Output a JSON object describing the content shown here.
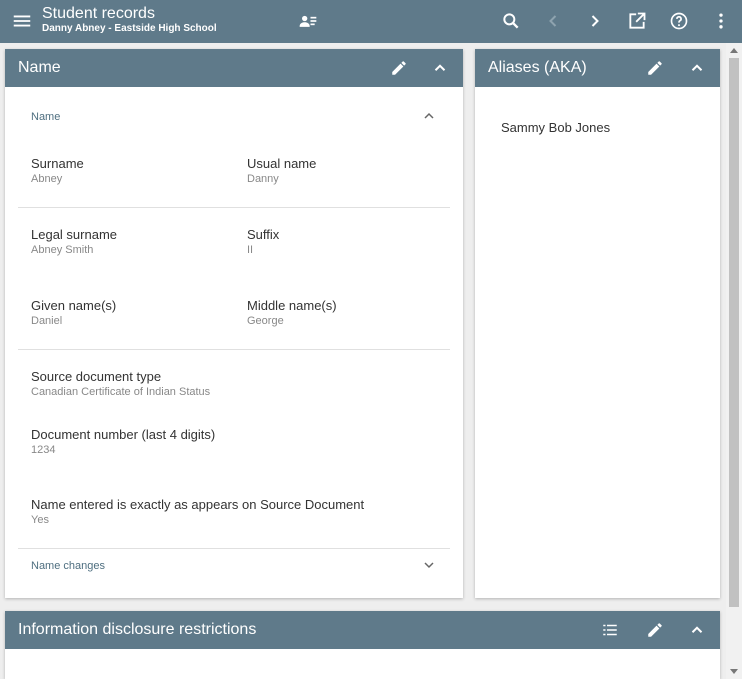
{
  "appbar": {
    "title": "Student records",
    "subtitle": "Danny Abney - Eastside High School",
    "icons": [
      "menu-icon",
      "student-card-icon",
      "search-icon",
      "chevron-left-icon",
      "chevron-right-icon",
      "open-in-new-icon",
      "help-icon",
      "more-vert-icon"
    ]
  },
  "name_card": {
    "title": "Name",
    "section_name": "Name",
    "fields": {
      "surname_label": "Surname",
      "surname_value": "Abney",
      "usual_label": "Usual name",
      "usual_value": "Danny",
      "legal_label": "Legal surname",
      "legal_value": "Abney Smith",
      "suffix_label": "Suffix",
      "suffix_value": "II",
      "given_label": "Given name(s)",
      "given_value": "Daniel",
      "middle_label": "Middle name(s)",
      "middle_value": "George",
      "source_label": "Source document type",
      "source_value": "Canadian Certificate of Indian Status",
      "docnum_label": "Document number (last 4 digits)",
      "docnum_value": "1234",
      "exact_label": "Name entered is exactly as appears on Source Document",
      "exact_value": "Yes"
    },
    "section_changes": "Name changes"
  },
  "aliases_card": {
    "title": "Aliases (AKA)",
    "alias": "Sammy Bob Jones"
  },
  "disclosure_card": {
    "title": "Information disclosure restrictions"
  },
  "colors": {
    "header": "#5f7a8a",
    "background": "#eeeeee",
    "section_text": "#4f6f80"
  }
}
